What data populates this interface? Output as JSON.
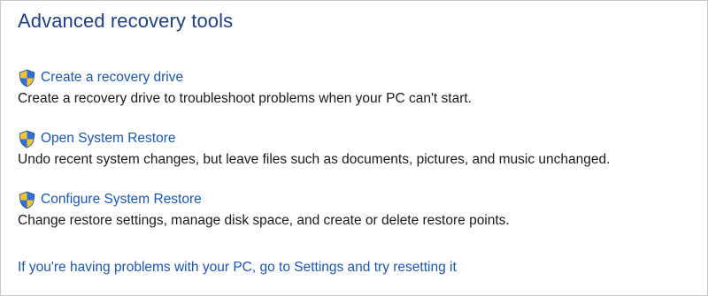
{
  "page": {
    "title": "Advanced recovery tools"
  },
  "tools": [
    {
      "link_label": "Create a recovery drive",
      "description": "Create a recovery drive to troubleshoot problems when your PC can't start.",
      "icon": "uac-shield-icon"
    },
    {
      "link_label": "Open System Restore",
      "description": "Undo recent system changes, but leave files such as documents, pictures, and music unchanged.",
      "icon": "uac-shield-icon"
    },
    {
      "link_label": "Configure System Restore",
      "description": "Change restore settings, manage disk space, and create or delete restore points.",
      "icon": "uac-shield-icon"
    }
  ],
  "footer": {
    "reset_link": "If you're having problems with your PC, go to Settings and try resetting it"
  },
  "colors": {
    "title": "#1e3f8c",
    "link": "#1a56b8",
    "text": "#1a1a1a",
    "shield_blue": "#2f6fd6",
    "shield_yellow": "#f4c430"
  }
}
